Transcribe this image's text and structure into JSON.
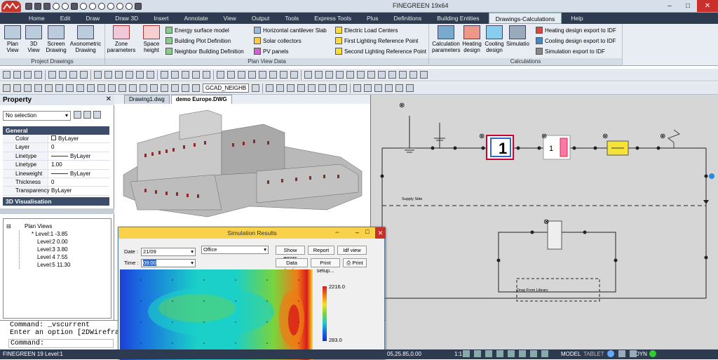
{
  "app": {
    "title": "FINEGREEN 19x64"
  },
  "menu_tabs": [
    "Home",
    "Edit",
    "Draw",
    "Draw 3D",
    "Insert",
    "Annotate",
    "View",
    "Output",
    "Tools",
    "Express Tools",
    "Plus",
    "Definitions",
    "Building Entities",
    "Drawings-Calculations",
    "Help"
  ],
  "active_tab": "Drawings-Calculations",
  "ribbon": {
    "project_drawings": {
      "label": "Project Drawings",
      "buttons": [
        "Plan View",
        "3D View",
        "Screen Drawing",
        "Axonometric Drawing"
      ]
    },
    "plan_view_data": {
      "label": "Plan View Data",
      "zone_parameters": "Zone parameters",
      "space_height": "Space height",
      "col1": [
        "Energy surface model",
        "Building Plot Definition",
        "Neighbor Building Definition"
      ],
      "col2": [
        "Horizontal cantilever Slab",
        "Solar collectors",
        "PV panels"
      ],
      "col3": [
        "Electric Load Centers",
        "First Lighting Reference Point",
        "Second Lighting Reference Point"
      ]
    },
    "calculations": {
      "label": "Calculations",
      "buttons": [
        "Calculation parameters",
        "Heating design",
        "Cooling design",
        "Simulatio"
      ],
      "exports": [
        "Heating design export to IDF",
        "Cooling design export to IDF",
        "Simulation export to IDF"
      ]
    }
  },
  "toolbar": {
    "layer_value": "GCAD_NEIGHB"
  },
  "property_panel": {
    "title": "Property",
    "selection": "No selection",
    "section_general": "General",
    "rows": [
      {
        "key": "Color",
        "value": "ByLayer"
      },
      {
        "key": "Layer",
        "value": "0"
      },
      {
        "key": "Linetype",
        "value": "ByLayer"
      },
      {
        "key": "Linetype scale",
        "value": "1.00"
      },
      {
        "key": "Lineweight",
        "value": "ByLayer"
      },
      {
        "key": "Thickness",
        "value": "0"
      },
      {
        "key": "Transparency",
        "value": "ByLayer"
      }
    ],
    "section_3d": "3D Visualisation"
  },
  "plan_views": {
    "root": "Plan Views",
    "levels": [
      "Level:1  -3.85",
      "Level:2  0.00",
      "Level:3  3.80",
      "Level 4  7.55",
      "Level:5  11.30"
    ]
  },
  "doc_tabs": [
    "Drawing1.dwg",
    "demo Europe.DWG"
  ],
  "diagram": {
    "supply_label": "Supply Side",
    "drag_label": "Drag From Library"
  },
  "simulation": {
    "title": "Simulation Results",
    "date_label": "Date :",
    "date_value": "21/09",
    "time_label": "Time :",
    "time_value": "09:00",
    "zone_value": "Office",
    "buttons": [
      "Show errors",
      "Report",
      "Idf view",
      "Data selection...",
      "Print setup...",
      "Print"
    ],
    "legend_max": "2216.0",
    "legend_min": "283.0",
    "legend_colors": [
      "#d81b1b",
      "#f07a16",
      "#f4e21a",
      "#7bd33c",
      "#1ad0c8",
      "#1b6ae0",
      "#1c2dc9"
    ]
  },
  "command": {
    "lines": [
      "Command: _vscurrent",
      "Enter an option [2DWireframe",
      "Command:"
    ]
  },
  "status": {
    "left": "FINEGREEN 19 Level:1",
    "coords": "05,25.85,0.00",
    "scale": "1:1",
    "model": "MODEL",
    "tablet": "TABLET",
    "dyn": "DYN"
  }
}
